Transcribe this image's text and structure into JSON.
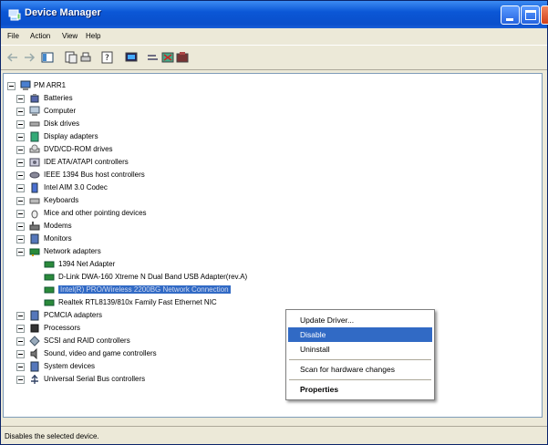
{
  "window": {
    "title": "Device Manager"
  },
  "menu": [
    "File",
    "Action",
    "View",
    "Help"
  ],
  "tree": {
    "root": "PM ARR1",
    "categories": [
      "Batteries",
      "Computer",
      "Disk drives",
      "Display adapters",
      "DVD/CD-ROM drives",
      "IDE ATA/ATAPI controllers",
      "IEEE 1394 Bus host controllers",
      "Intel AIM 3.0 Codec",
      "Keyboards",
      "Mice and other pointing devices",
      "Modems",
      "Monitors",
      "Network adapters"
    ],
    "network_children": [
      "1394 Net Adapter",
      "D-Link DWA-160 Xtreme N Dual Band USB Adapter(rev.A)",
      "Intel(R) PRO/Wireless 2200BG Network Connection",
      "Realtek RTL8139/810x Family Fast Ethernet NIC"
    ],
    "categories_after": [
      "PCMCIA adapters",
      "Processors",
      "SCSI and RAID controllers",
      "Sound, video and game controllers",
      "System devices",
      "Universal Serial Bus controllers"
    ]
  },
  "context_menu": {
    "update": "Update Driver...",
    "disable": "Disable",
    "uninstall": "Uninstall",
    "scan": "Scan for hardware changes",
    "properties": "Properties"
  },
  "status": "Disables the selected device."
}
